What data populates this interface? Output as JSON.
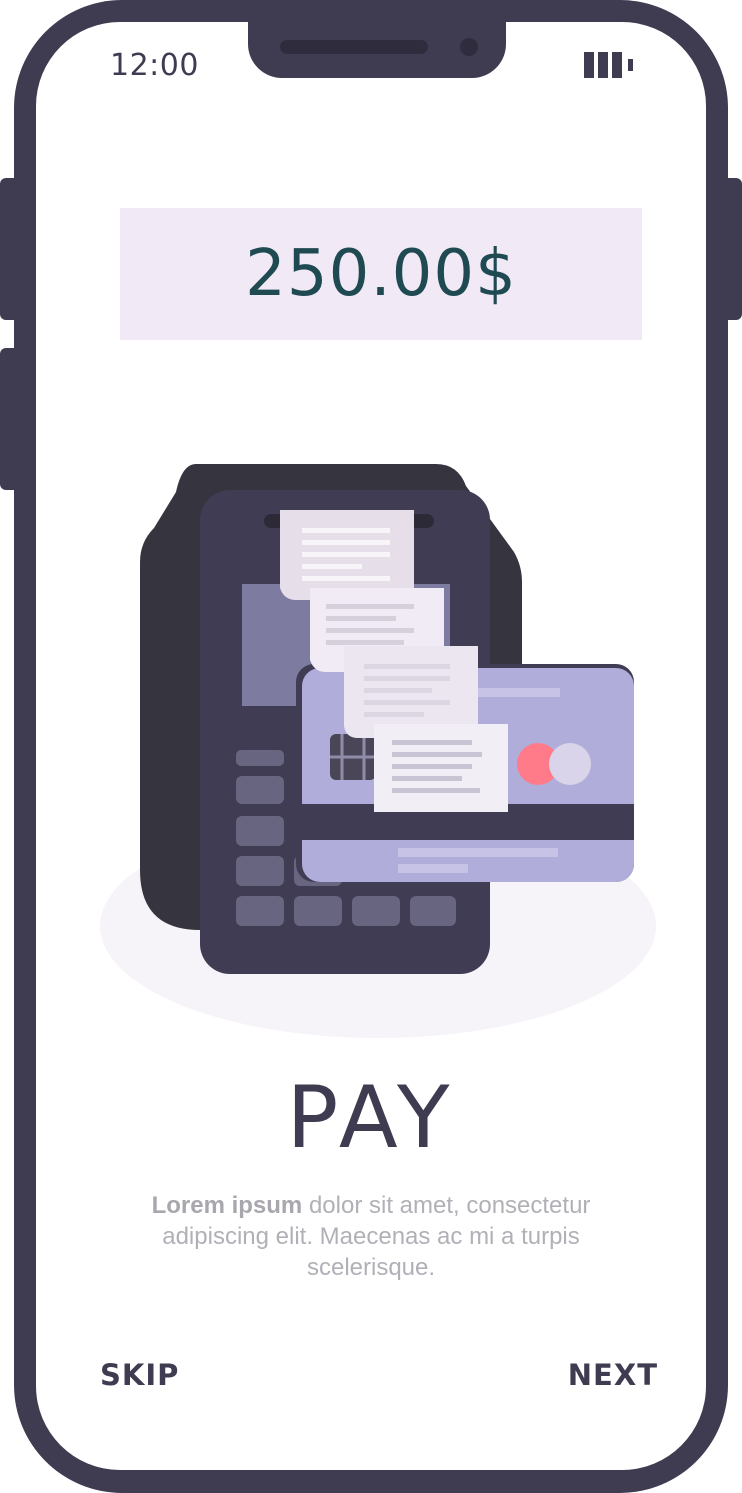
{
  "status_bar": {
    "time": "12:00",
    "battery_icon": "battery-icon"
  },
  "amount": {
    "value": "250.00$"
  },
  "illustration": {
    "name": "payment-terminal-illustration"
  },
  "content": {
    "title": "PAY",
    "description_bold": "Lorem ipsum",
    "description_rest": " dolor sit amet, consectetur adipiscing elit. Maecenas ac mi a turpis scelerisque."
  },
  "nav": {
    "skip_label": "SKIP",
    "next_label": "NEXT"
  },
  "colors": {
    "frame": "#3f3c52",
    "amount_bg": "#f1eaf6",
    "amount_text": "#1f4a52",
    "card": "#b0addb",
    "description": "#b2b0b7"
  }
}
